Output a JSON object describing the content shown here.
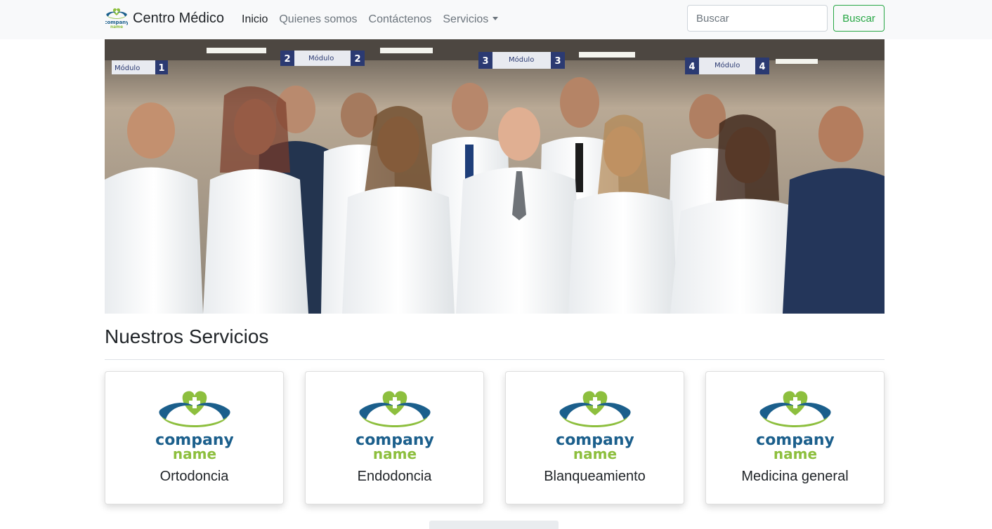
{
  "navbar": {
    "brand_text": "Centro Médico",
    "logo_line1": "company",
    "logo_line2": "name",
    "links": [
      {
        "label": "Inicio",
        "active": true
      },
      {
        "label": "Quienes somos",
        "active": false
      },
      {
        "label": "Contáctenos",
        "active": false
      },
      {
        "label": "Servicios",
        "active": false,
        "dropdown": true
      }
    ],
    "search": {
      "placeholder": "Buscar",
      "value": ""
    },
    "search_button": "Buscar"
  },
  "hero": {
    "modules": [
      {
        "label": "Módulo",
        "number": "1"
      },
      {
        "label": "Módulo",
        "number": "2"
      },
      {
        "label": "Módulo",
        "number": "3"
      },
      {
        "label": "Módulo",
        "number": "4"
      }
    ]
  },
  "services": {
    "title": "Nuestros Servicios",
    "items": [
      {
        "name": "Ortodoncia",
        "logo_line1": "company",
        "logo_line2": "name"
      },
      {
        "name": "Endodoncia",
        "logo_line1": "company",
        "logo_line2": "name"
      },
      {
        "name": "Blanqueamiento",
        "logo_line1": "company",
        "logo_line2": "name"
      },
      {
        "name": "Medicina general",
        "logo_line1": "company",
        "logo_line2": "name"
      }
    ]
  },
  "colors": {
    "navbar_bg": "#f8f9fa",
    "success_green": "#28a745",
    "logo_green": "#8dbf3e",
    "logo_blue": "#1b5f8c"
  },
  "icons": {
    "brand": "company-logo-icon",
    "card": "company-logo-icon",
    "dropdown": "caret-down-icon"
  }
}
